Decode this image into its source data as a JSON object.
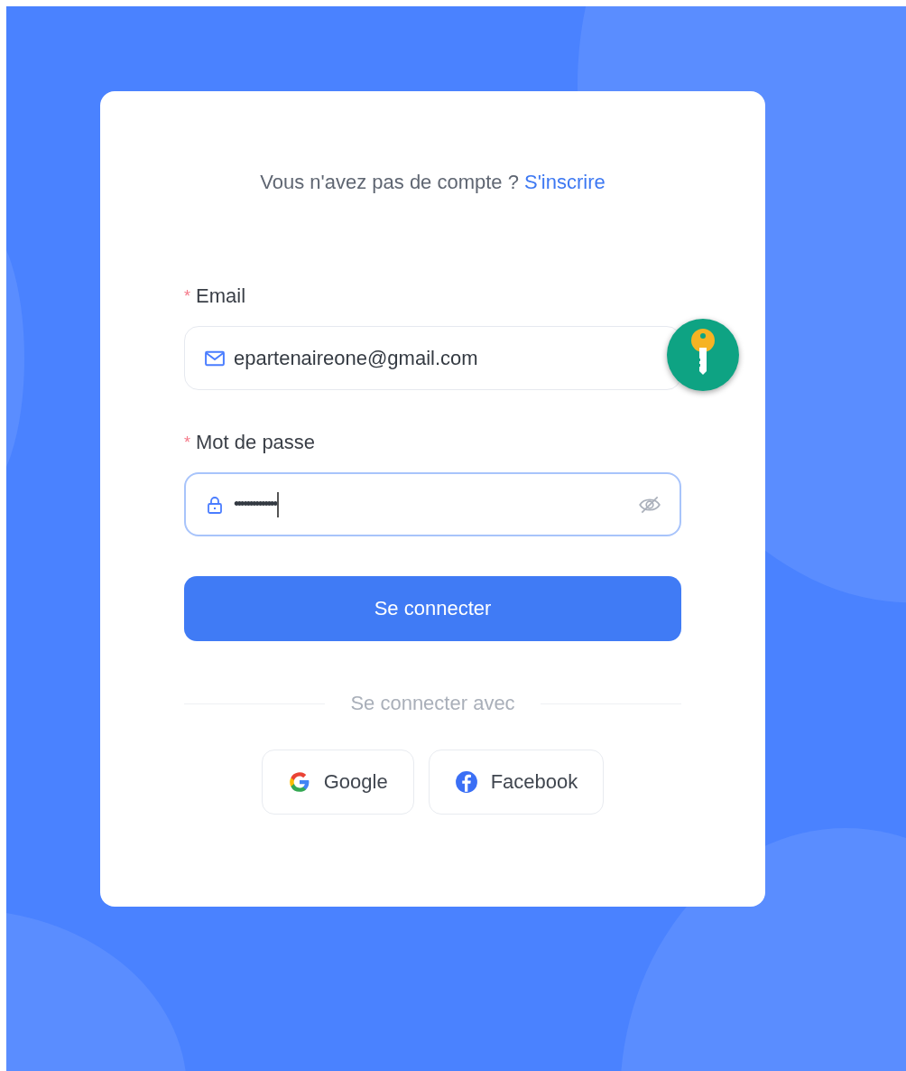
{
  "signup_prompt": {
    "text": "Vous n'avez pas de compte ?",
    "link": "S'inscrire"
  },
  "fields": [
    {
      "kind": "email",
      "label": "Email",
      "required_mark": "*",
      "value": "epartenaireone@gmail.com",
      "focused": false
    },
    {
      "kind": "password",
      "label": "Mot de passe",
      "required_mark": "*",
      "value": "••••••••••••••",
      "focused": true
    }
  ],
  "submit": "Se connecter",
  "divider": "Se connecter avec",
  "social": [
    {
      "kind": "google",
      "label": "Google"
    },
    {
      "kind": "facebook",
      "label": "Facebook"
    }
  ]
}
